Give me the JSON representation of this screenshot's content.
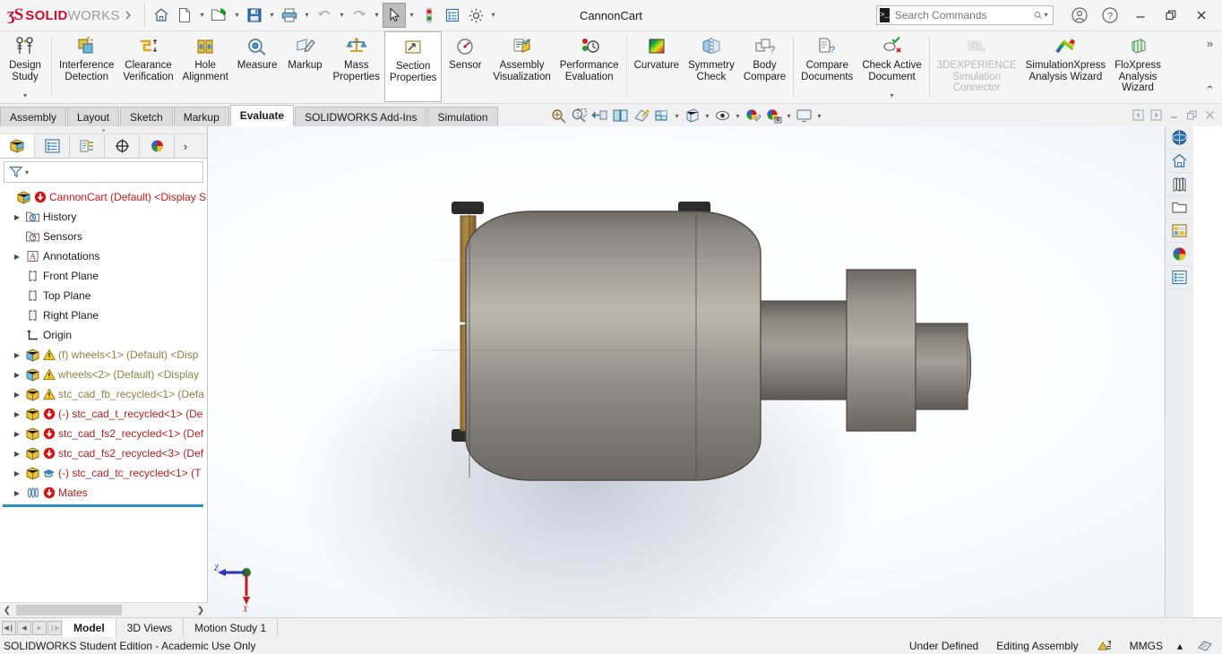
{
  "app": {
    "brand_mark": "ʒS",
    "brand_bold": "SOLID",
    "brand_light": "WORKS",
    "document_title": "CannonCart"
  },
  "quick_access": [
    {
      "name": "home-icon",
      "label": "Home"
    },
    {
      "name": "new-document-icon",
      "label": "New"
    },
    {
      "name": "open-folder-icon",
      "label": "Open"
    },
    {
      "name": "save-icon",
      "label": "Save"
    },
    {
      "name": "print-icon",
      "label": "Print"
    },
    {
      "name": "undo-icon",
      "label": "Undo"
    },
    {
      "name": "redo-icon",
      "label": "Redo"
    },
    {
      "name": "select-cursor-icon",
      "label": "Select"
    },
    {
      "name": "rebuild-icon",
      "label": "Rebuild"
    },
    {
      "name": "file-properties-icon",
      "label": "File Properties"
    },
    {
      "name": "options-gear-icon",
      "label": "Options"
    }
  ],
  "search": {
    "placeholder": "Search Commands",
    "value": ""
  },
  "window_controls": {
    "account": "ⓧ",
    "help": "?",
    "minimize": "–",
    "restore": "❐",
    "close": "✕"
  },
  "ribbon": {
    "groups": [
      {
        "items": [
          {
            "label_line1": "Design",
            "label_line2": "Study",
            "icon": "design-study-icon",
            "dropdown": true,
            "disabled": false,
            "boxed": false
          }
        ]
      },
      {
        "items": [
          {
            "label_line1": "Interference",
            "label_line2": "Detection",
            "icon": "interference-detection-icon",
            "dropdown": false,
            "disabled": false,
            "boxed": false
          },
          {
            "label_line1": "Clearance",
            "label_line2": "Verification",
            "icon": "clearance-verification-icon",
            "dropdown": false,
            "disabled": false,
            "boxed": false
          },
          {
            "label_line1": "Hole",
            "label_line2": "Alignment",
            "icon": "hole-alignment-icon",
            "dropdown": false,
            "disabled": false,
            "boxed": false
          },
          {
            "label_line1": "Measure",
            "label_line2": "",
            "icon": "measure-icon",
            "dropdown": false,
            "disabled": false,
            "boxed": false
          },
          {
            "label_line1": "Markup",
            "label_line2": "",
            "icon": "markup-icon",
            "dropdown": false,
            "disabled": false,
            "boxed": false
          },
          {
            "label_line1": "Mass",
            "label_line2": "Properties",
            "icon": "mass-properties-icon",
            "dropdown": false,
            "disabled": false,
            "boxed": false
          },
          {
            "label_line1": "Section",
            "label_line2": "Properties",
            "icon": "section-properties-icon",
            "dropdown": false,
            "disabled": false,
            "boxed": true
          },
          {
            "label_line1": "Sensor",
            "label_line2": "",
            "icon": "sensor-icon",
            "dropdown": false,
            "disabled": false,
            "boxed": false
          },
          {
            "label_line1": "Assembly",
            "label_line2": "Visualization",
            "icon": "assembly-visualization-icon",
            "dropdown": false,
            "disabled": false,
            "boxed": false
          },
          {
            "label_line1": "Performance",
            "label_line2": "Evaluation",
            "icon": "performance-evaluation-icon",
            "dropdown": false,
            "disabled": false,
            "boxed": false
          }
        ]
      },
      {
        "items": [
          {
            "label_line1": "Curvature",
            "label_line2": "",
            "icon": "curvature-icon",
            "dropdown": false,
            "disabled": false,
            "boxed": false
          },
          {
            "label_line1": "Symmetry",
            "label_line2": "Check",
            "icon": "symmetry-check-icon",
            "dropdown": false,
            "disabled": false,
            "boxed": false
          },
          {
            "label_line1": "Body",
            "label_line2": "Compare",
            "icon": "body-compare-icon",
            "dropdown": false,
            "disabled": false,
            "boxed": false
          }
        ]
      },
      {
        "items": [
          {
            "label_line1": "Compare",
            "label_line2": "Documents",
            "icon": "compare-documents-icon",
            "dropdown": false,
            "disabled": false,
            "boxed": false
          },
          {
            "label_line1": "Check Active",
            "label_line2": "Document",
            "icon": "check-active-document-icon",
            "dropdown": true,
            "disabled": false,
            "boxed": false
          }
        ]
      },
      {
        "items": [
          {
            "label_line1": "3DEXPERIENCE",
            "label_line2": "Simulation",
            "label_line3": "Connector",
            "icon": "3dexperience-simulation-connector-icon",
            "dropdown": false,
            "disabled": true,
            "boxed": false
          },
          {
            "label_line1": "SimulationXpress",
            "label_line2": "Analysis Wizard",
            "icon": "simulationxpress-analysis-wizard-icon",
            "dropdown": false,
            "disabled": false,
            "boxed": false
          },
          {
            "label_line1": "FloXpress",
            "label_line2": "Analysis",
            "label_line3": "Wizard",
            "icon": "floxpress-analysis-wizard-icon",
            "dropdown": false,
            "disabled": false,
            "boxed": false
          }
        ]
      }
    ],
    "expand_chevron": "»",
    "collapse_chevron": "⌃"
  },
  "command_tabs": [
    {
      "label": "Assembly",
      "active": false
    },
    {
      "label": "Layout",
      "active": false
    },
    {
      "label": "Sketch",
      "active": false
    },
    {
      "label": "Markup",
      "active": false
    },
    {
      "label": "Evaluate",
      "active": true
    },
    {
      "label": "SOLIDWORKS Add-Ins",
      "active": false
    },
    {
      "label": "Simulation",
      "active": false
    }
  ],
  "view_toolbar": [
    {
      "name": "zoom-to-fit-icon",
      "caret": false
    },
    {
      "name": "zoom-to-area-icon",
      "caret": false
    },
    {
      "name": "section-view-icon",
      "caret": false
    },
    {
      "name": "view-orientation-icon",
      "caret": false
    },
    {
      "name": "3d-drawing-view-icon",
      "caret": false
    },
    {
      "name": "display-style-icon",
      "caret": true
    },
    {
      "name": "hide-show-items-icon",
      "caret": true
    },
    {
      "name": "view-settings-icon",
      "caret": true
    },
    {
      "name": "apply-scene-icon",
      "caret": false
    },
    {
      "name": "appearances-icon",
      "caret": true
    },
    {
      "name": "viewport-layout-icon",
      "caret": true
    }
  ],
  "doc_window_controls": {
    "prev": "◀",
    "next": "▶",
    "minimize": "—",
    "restore": "❐",
    "close": "✕"
  },
  "feature_manager": {
    "tabs": [
      {
        "name": "feature-manager-design-tree-tab",
        "active": true
      },
      {
        "name": "property-manager-tab",
        "active": false
      },
      {
        "name": "configuration-manager-tab",
        "active": false
      },
      {
        "name": "dimxpert-manager-tab",
        "active": false
      },
      {
        "name": "display-manager-tab",
        "active": false
      }
    ],
    "more_tabs": "›",
    "filter_placeholder": "",
    "tree": [
      {
        "label": "CannonCart (Default) <Display St",
        "color": "red",
        "icon": "assembly-icon",
        "status_icon": "rebuild-error-icon",
        "expandable": false,
        "indent": 0,
        "root": true
      },
      {
        "label": "History",
        "color": "black",
        "icon": "history-folder-icon",
        "status_icon": "",
        "expandable": true,
        "indent": 1
      },
      {
        "label": "Sensors",
        "color": "black",
        "icon": "sensors-folder-icon",
        "status_icon": "",
        "expandable": false,
        "indent": 1
      },
      {
        "label": "Annotations",
        "color": "black",
        "icon": "annotations-icon",
        "status_icon": "",
        "expandable": true,
        "indent": 1
      },
      {
        "label": "Front Plane",
        "color": "black",
        "icon": "plane-icon",
        "status_icon": "",
        "expandable": false,
        "indent": 1
      },
      {
        "label": "Top Plane",
        "color": "black",
        "icon": "plane-icon",
        "status_icon": "",
        "expandable": false,
        "indent": 1
      },
      {
        "label": "Right Plane",
        "color": "black",
        "icon": "plane-icon",
        "status_icon": "",
        "expandable": false,
        "indent": 1
      },
      {
        "label": "Origin",
        "color": "black",
        "icon": "origin-icon",
        "status_icon": "",
        "expandable": false,
        "indent": 1
      },
      {
        "label": "(f) wheels<1> (Default) <Disp",
        "color": "olive",
        "icon": "part-blue-icon",
        "status_icon": "warning-icon",
        "expandable": true,
        "indent": 1
      },
      {
        "label": "wheels<2> (Default) <Display",
        "color": "olive",
        "icon": "part-blue-icon",
        "status_icon": "warning-icon",
        "expandable": true,
        "indent": 1
      },
      {
        "label": "stc_cad_fb_recycled<1> (Defa",
        "color": "olive",
        "icon": "part-yellow-icon",
        "status_icon": "warning-icon",
        "expandable": true,
        "indent": 1
      },
      {
        "label": "(-) stc_cad_t_recycled<1> (De",
        "color": "dred",
        "icon": "part-yellow-icon",
        "status_icon": "rebuild-error-icon",
        "expandable": true,
        "indent": 1
      },
      {
        "label": "stc_cad_fs2_recycled<1> (Def",
        "color": "dred",
        "icon": "part-yellow-icon",
        "status_icon": "rebuild-error-icon",
        "expandable": true,
        "indent": 1
      },
      {
        "label": "stc_cad_fs2_recycled<3> (Def",
        "color": "dred",
        "icon": "part-yellow-icon",
        "status_icon": "rebuild-error-icon",
        "expandable": true,
        "indent": 1
      },
      {
        "label": "(-) stc_cad_tc_recycled<1> (T",
        "color": "dred",
        "icon": "part-yellow-icon",
        "status_icon": "toolbox-icon",
        "expandable": true,
        "indent": 1
      },
      {
        "label": "Mates",
        "color": "dred",
        "icon": "mates-icon",
        "status_icon": "rebuild-error-icon",
        "expandable": true,
        "indent": 1
      }
    ]
  },
  "task_pane": [
    {
      "name": "3dexperience-icon"
    },
    {
      "name": "solidworks-resources-home-icon"
    },
    {
      "name": "design-library-icon"
    },
    {
      "name": "file-explorer-icon"
    },
    {
      "name": "view-palette-icon"
    },
    {
      "name": "appearances-scenes-decals-icon"
    },
    {
      "name": "custom-properties-icon"
    }
  ],
  "viewport": {
    "triad": {
      "z_label": "Z",
      "x_label": "X",
      "z_color": "#2f2fbf",
      "x_color": "#c01c1c",
      "origin_color": "#1f7a1f"
    },
    "model_colors": {
      "steel_light": "#b9b5ad",
      "steel_mid": "#8a8680",
      "steel_dark": "#6c6862",
      "wood": "#a07b3c",
      "rubber": "#2b2b2b"
    }
  },
  "bottom_tabs": [
    {
      "label": "Model",
      "active": true
    },
    {
      "label": "3D Views",
      "active": false
    },
    {
      "label": "Motion Study 1",
      "active": false
    }
  ],
  "nav_arrows": [
    "◀❙",
    "◀",
    "▶",
    "❙▶"
  ],
  "status_bar": {
    "message": "SOLIDWORKS Student Edition - Academic Use Only",
    "state": "Under Defined",
    "mode": "Editing Assembly",
    "units": "MMGS",
    "units_caret": "▴",
    "overlay_icon": "sketch-status-icon",
    "tail_icon": "custom-icon"
  }
}
